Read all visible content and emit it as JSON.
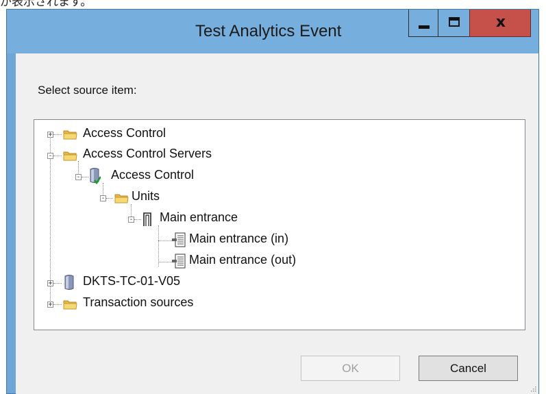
{
  "page_caption": "が表示されます。",
  "window": {
    "title": "Test Analytics Event",
    "minimize_icon": "minimize-icon",
    "maximize_icon": "maximize-icon",
    "close_glyph": "x"
  },
  "dialog": {
    "prompt": "Select source item:",
    "ok_label": "OK",
    "ok_enabled": false,
    "cancel_label": "Cancel"
  },
  "tree": {
    "nodes": [
      {
        "label": "Access Control",
        "icon": "folder-icon",
        "expander": "+",
        "level": 0
      },
      {
        "label": "Access Control Servers",
        "icon": "folder-icon",
        "expander": "-",
        "level": 0
      },
      {
        "label": "Access Control",
        "icon": "server-check-icon",
        "expander": "-",
        "level": 1
      },
      {
        "label": "Units",
        "icon": "folder-icon",
        "expander": "-",
        "level": 2
      },
      {
        "label": "Main entrance",
        "icon": "door-icon",
        "expander": "-",
        "level": 3
      },
      {
        "label": "Main entrance (in)",
        "icon": "reader-icon",
        "expander": "",
        "level": 4
      },
      {
        "label": "Main entrance (out)",
        "icon": "reader-icon",
        "expander": "",
        "level": 4
      },
      {
        "label": "DKTS-TC-01-V05",
        "icon": "server-icon",
        "expander": "+",
        "level": 0
      },
      {
        "label": "Transaction sources",
        "icon": "folder-icon",
        "expander": "+",
        "level": 0
      }
    ]
  },
  "colors": {
    "titlebar": "#76aedd",
    "close_button": "#c6504a",
    "client_bg": "#f0f0f0",
    "folder": "#f2d36b"
  }
}
